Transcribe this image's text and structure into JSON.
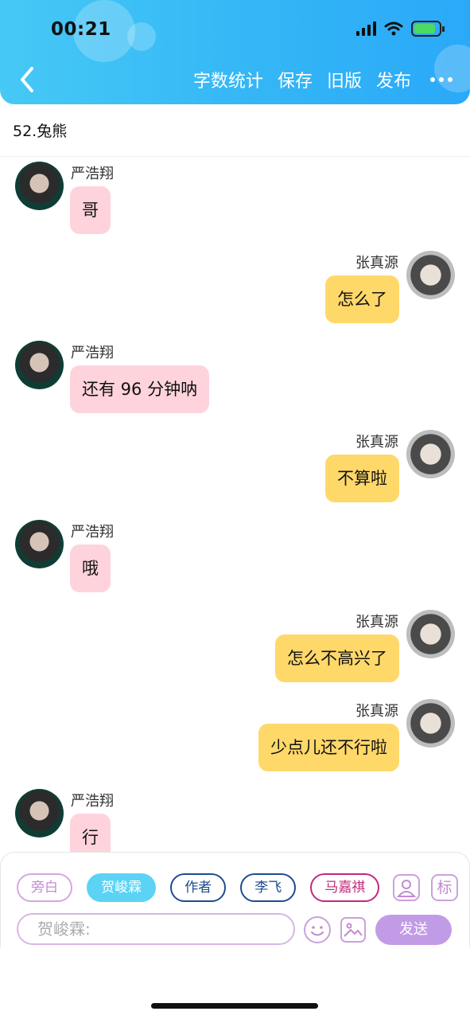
{
  "status_bar": {
    "time": "00:21",
    "battery_color": "#4cd964"
  },
  "header": {
    "back_icon": "chevron-left-icon",
    "actions": {
      "word_count": "字数统计",
      "save": "保存",
      "old_version": "旧版",
      "publish": "发布"
    },
    "more_icon": "more-horizontal-icon"
  },
  "chapter": {
    "title": "52.兔熊"
  },
  "messages": [
    {
      "side": "left",
      "name": "严浩翔",
      "text": "哥"
    },
    {
      "side": "right",
      "name": "张真源",
      "text": "怎么了"
    },
    {
      "side": "left",
      "name": "严浩翔",
      "text": "还有 96 分钟呐"
    },
    {
      "side": "right",
      "name": "张真源",
      "text": "不算啦"
    },
    {
      "side": "left",
      "name": "严浩翔",
      "text": "哦"
    },
    {
      "side": "right",
      "name": "张真源",
      "text": "怎么不高兴了"
    },
    {
      "side": "right",
      "name": "张真源",
      "text": "少点儿还不行啦"
    },
    {
      "side": "left",
      "name": "严浩翔",
      "text": "行"
    }
  ],
  "composer": {
    "roles": [
      "旁白",
      "贺峻霖",
      "作者",
      "李飞",
      "马嘉祺"
    ],
    "selected_role": "贺峻霖",
    "tag_label": "标",
    "input_placeholder": "贺峻霖:",
    "send_label": "发送",
    "colors": {
      "accent": "#5bd3f5",
      "send": "#c29be6",
      "left_bubble": "#ffd3dc",
      "right_bubble": "#ffd86a"
    }
  }
}
